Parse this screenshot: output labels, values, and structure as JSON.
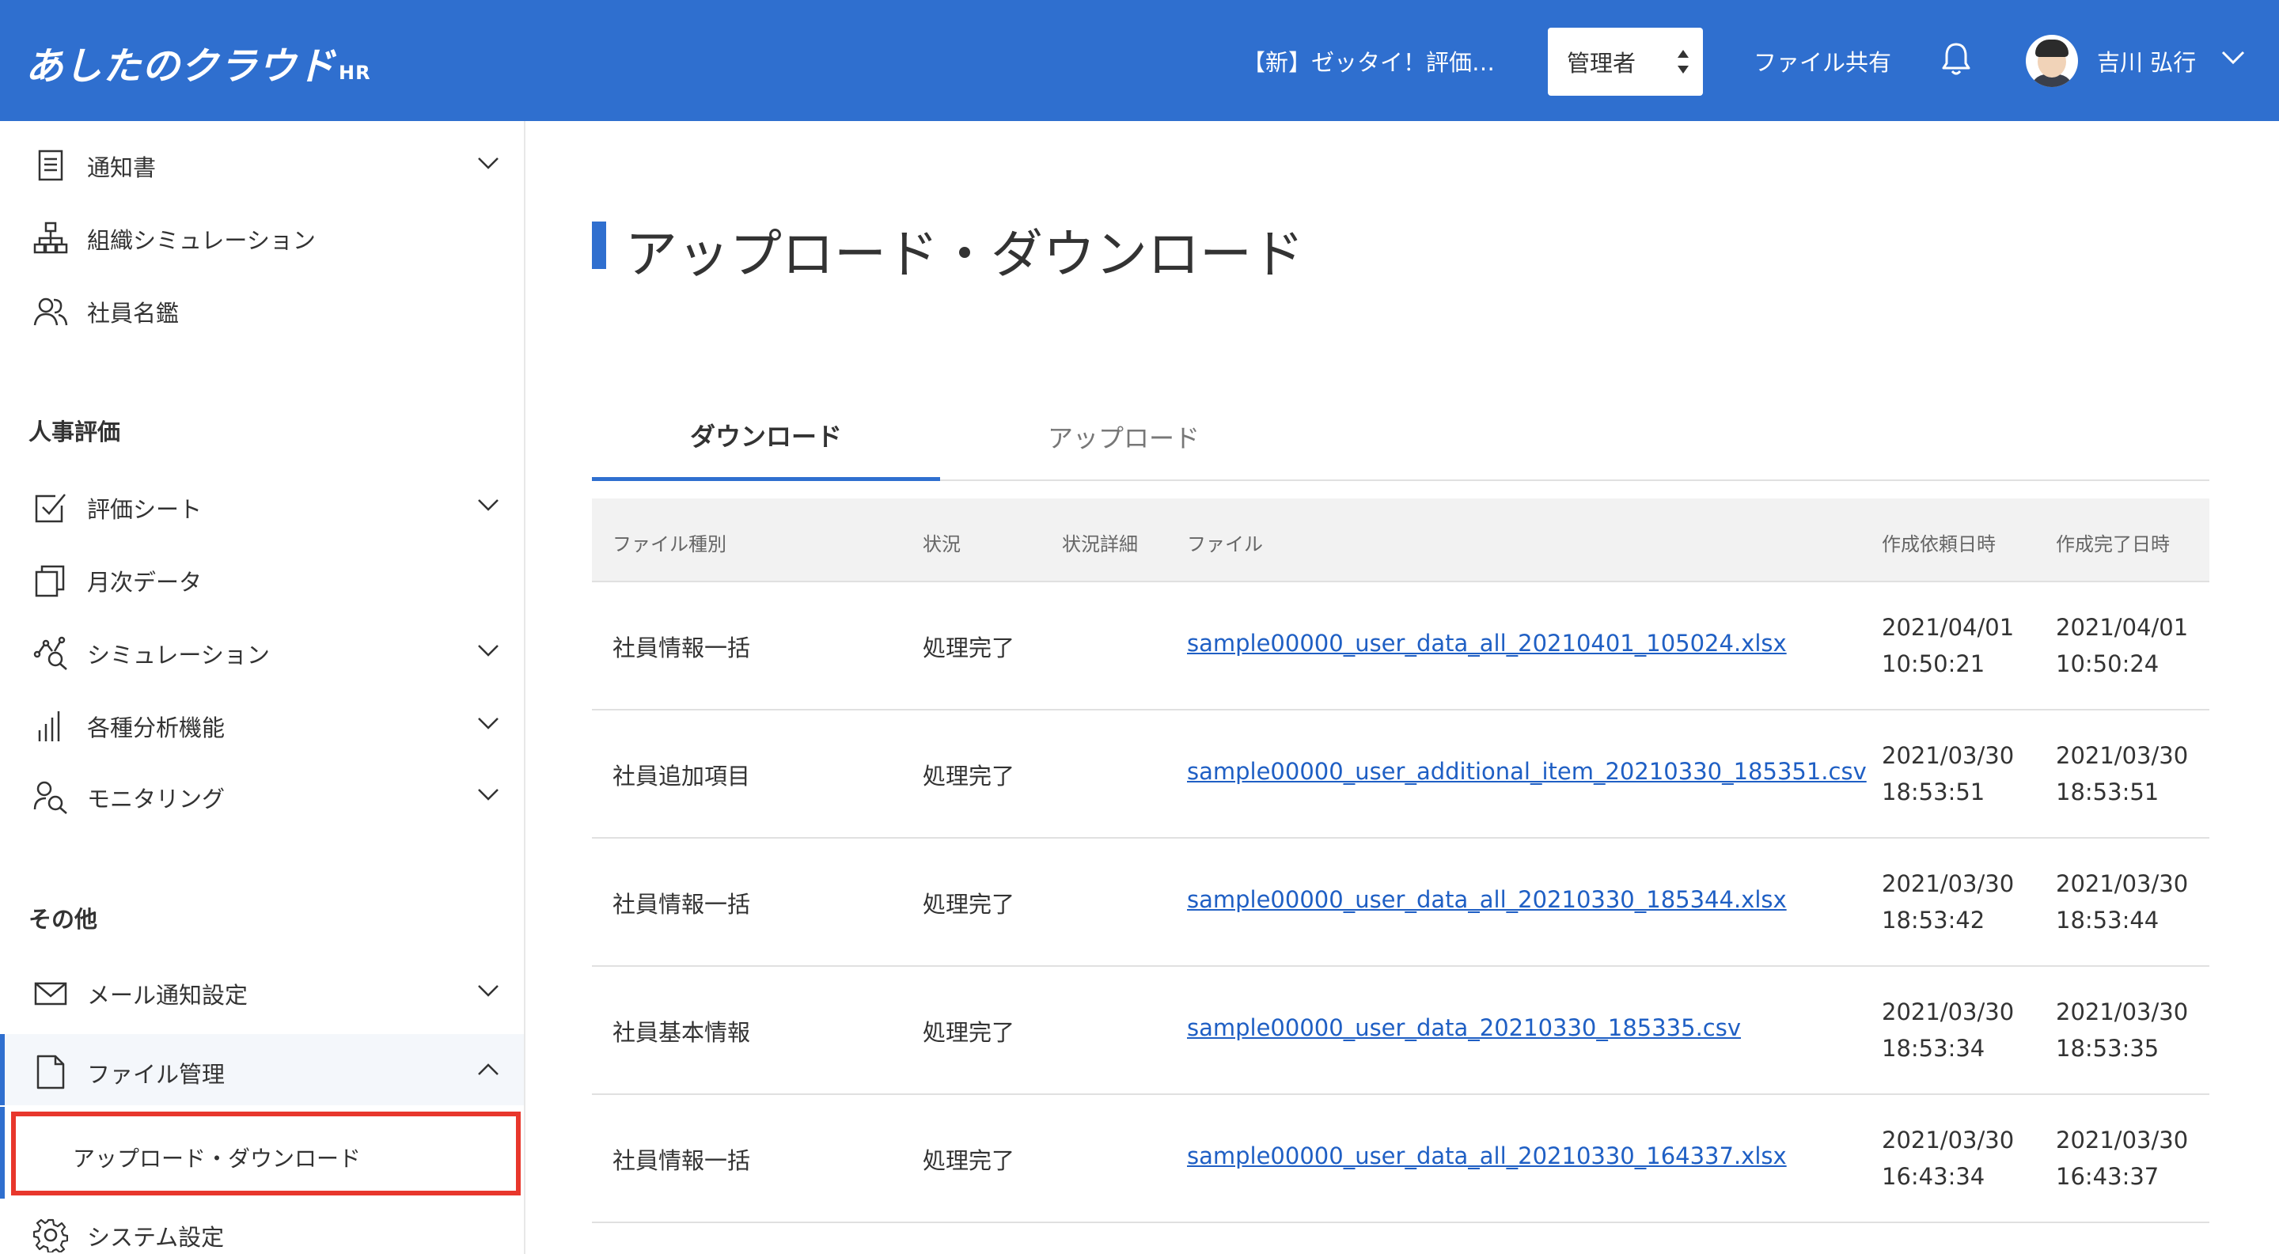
{
  "header": {
    "logo": "あしたのクラウド",
    "logo_suffix": "HR",
    "notice": "【新】ゼッタイ！評価…",
    "role": "管理者",
    "file_share": "ファイル共有",
    "user_name": "吉川 弘行",
    "icons": [
      "bell-icon",
      "avatar",
      "chevron-down-icon"
    ]
  },
  "sidebar": {
    "items_top": [
      {
        "label": "通知書",
        "icon": "document-icon",
        "has_chevron": true
      },
      {
        "label": "組織シミュレーション",
        "icon": "org-chart-icon",
        "has_chevron": false
      },
      {
        "label": "社員名鑑",
        "icon": "people-icon",
        "has_chevron": false
      }
    ],
    "section_hr": "人事評価",
    "items_hr": [
      {
        "label": "評価シート",
        "icon": "checkbox-icon",
        "has_chevron": true
      },
      {
        "label": "月次データ",
        "icon": "copy-icon",
        "has_chevron": false
      },
      {
        "label": "シミュレーション",
        "icon": "analytics-icon",
        "has_chevron": true
      },
      {
        "label": "各種分析機能",
        "icon": "bar-chart-icon",
        "has_chevron": true
      },
      {
        "label": "モニタリング",
        "icon": "user-search-icon",
        "has_chevron": true
      }
    ],
    "section_other": "その他",
    "items_other": [
      {
        "label": "メール通知設定",
        "icon": "mail-icon",
        "has_chevron": true
      },
      {
        "label": "ファイル管理",
        "icon": "file-icon",
        "has_chevron": true
      },
      {
        "label": "システム設定",
        "icon": "gear-icon",
        "has_chevron": false
      }
    ],
    "sub_item": "アップロード・ダウンロード"
  },
  "main": {
    "title": "アップロード・ダウンロード",
    "tabs": [
      {
        "label": "ダウンロード",
        "active": true
      },
      {
        "label": "アップロード",
        "active": false
      }
    ],
    "table": {
      "headers": [
        "ファイル種別",
        "状況",
        "状況詳細",
        "ファイル",
        "作成依頼日時",
        "作成完了日時"
      ],
      "rows": [
        {
          "type": "社員情報一括",
          "status": "処理完了",
          "detail": "",
          "file": "sample00000_user_data_all_20210401_105024.xlsx",
          "requested_date": "2021/04/01",
          "requested_time": "10:50:21",
          "completed_date": "2021/04/01",
          "completed_time": "10:50:24"
        },
        {
          "type": "社員追加項目",
          "status": "処理完了",
          "detail": "",
          "file": "sample00000_user_additional_item_20210330_185351.csv",
          "requested_date": "2021/03/30",
          "requested_time": "18:53:51",
          "completed_date": "2021/03/30",
          "completed_time": "18:53:51"
        },
        {
          "type": "社員情報一括",
          "status": "処理完了",
          "detail": "",
          "file": "sample00000_user_data_all_20210330_185344.xlsx",
          "requested_date": "2021/03/30",
          "requested_time": "18:53:42",
          "completed_date": "2021/03/30",
          "completed_time": "18:53:44"
        },
        {
          "type": "社員基本情報",
          "status": "処理完了",
          "detail": "",
          "file": "sample00000_user_data_20210330_185335.csv",
          "requested_date": "2021/03/30",
          "requested_time": "18:53:34",
          "completed_date": "2021/03/30",
          "completed_time": "18:53:35"
        },
        {
          "type": "社員情報一括",
          "status": "処理完了",
          "detail": "",
          "file": "sample00000_user_data_all_20210330_164337.xlsx",
          "requested_date": "2021/03/30",
          "requested_time": "16:43:34",
          "completed_date": "2021/03/30",
          "completed_time": "16:43:37"
        }
      ]
    }
  },
  "colors": {
    "brand": "#2f6fcf",
    "link": "#1f5fc4",
    "highlight": "#e8372c"
  }
}
